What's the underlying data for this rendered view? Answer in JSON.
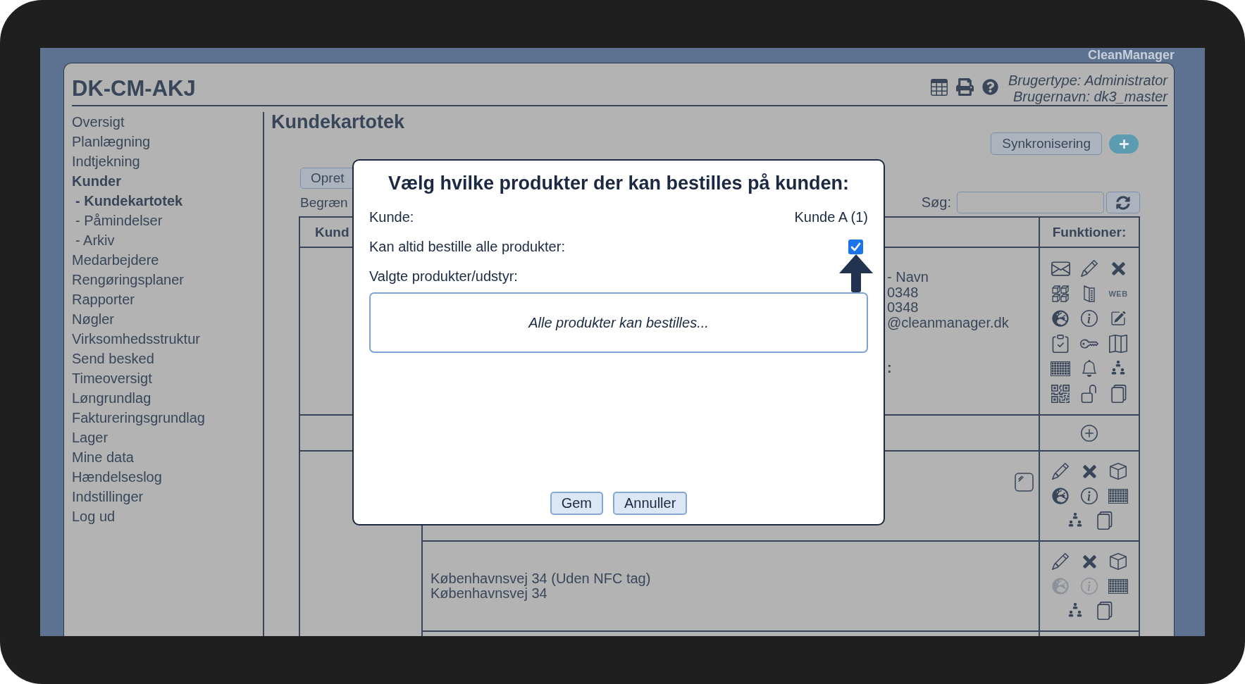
{
  "app_label": "CleanManager",
  "header": {
    "title": "DK-CM-AKJ",
    "user_type": "Brugertype: Administrator",
    "user_name": "Brugernavn: dk3_master"
  },
  "sidebar": {
    "items": [
      {
        "label": "Oversigt",
        "selected": false
      },
      {
        "label": "Planlægning",
        "selected": false
      },
      {
        "label": "Indtjekning",
        "selected": false
      },
      {
        "label": "Kunder",
        "selected": true,
        "children": [
          {
            "label": "- Kundekartotek",
            "selected": true
          },
          {
            "label": "- Påmindelser",
            "selected": false
          },
          {
            "label": "- Arkiv",
            "selected": false
          }
        ]
      },
      {
        "label": "Medarbejdere",
        "selected": false
      },
      {
        "label": "Rengøringsplaner",
        "selected": false
      },
      {
        "label": "Rapporter",
        "selected": false
      },
      {
        "label": "Nøgler",
        "selected": false
      },
      {
        "label": "Virksomhedsstruktur",
        "selected": false
      },
      {
        "label": "Send besked",
        "selected": false
      },
      {
        "label": "Timeoversigt",
        "selected": false
      },
      {
        "label": "Løngrundlag",
        "selected": false
      },
      {
        "label": "Faktureringsgrundlag",
        "selected": false
      },
      {
        "label": "Lager",
        "selected": false
      },
      {
        "label": "Mine data",
        "selected": false
      },
      {
        "label": "Hændelseslog",
        "selected": false
      },
      {
        "label": "Indstillinger",
        "selected": false
      },
      {
        "label": "Log ud",
        "selected": false
      }
    ]
  },
  "page": {
    "title": "Kundekartotek",
    "sync_button": "Synkronisering",
    "create_button": "Opret",
    "filter_label": "Begræn",
    "search": {
      "label": "Søg:"
    }
  },
  "table": {
    "columns": [
      "Kund",
      "Funktioner:"
    ],
    "rows": [
      {
        "kind": "customer",
        "details": [
          "- Navn",
          "0348",
          "0348",
          "@cleanmanager.dk"
        ],
        "details_tail": ":",
        "functions": [
          {
            "disabled": false
          },
          {
            "disabled": false
          },
          {
            "disabled": false
          },
          {
            "disabled": false
          },
          {
            "disabled": false
          },
          {
            "label": "WEB",
            "disabled": false
          },
          {
            "disabled": false
          },
          {
            "disabled": false
          },
          {
            "disabled": false
          },
          {
            "disabled": false
          },
          {
            "disabled": false
          },
          {
            "disabled": false
          },
          {
            "disabled": false
          },
          {
            "disabled": false
          },
          {
            "disabled": false
          },
          {
            "disabled": false
          },
          {
            "disabled": false
          },
          {
            "disabled": false
          }
        ]
      },
      {
        "kind": "add",
        "functions": [
          {
            "disabled": false
          }
        ]
      },
      {
        "kind": "address",
        "marked": true,
        "functions": [
          {
            "disabled": false
          },
          {
            "disabled": false
          },
          {
            "disabled": false
          },
          {
            "disabled": false
          },
          {
            "disabled": false
          },
          {
            "disabled": false
          },
          {
            "disabled": false
          },
          {
            "disabled": false
          }
        ]
      },
      {
        "kind": "address",
        "lines": [
          "Københavnsvej 34 (Uden NFC tag)",
          "Københavnsvej 34"
        ],
        "functions": [
          {
            "disabled": false
          },
          {
            "disabled": false
          },
          {
            "disabled": false
          },
          {
            "disabled": true
          },
          {
            "disabled": true
          },
          {
            "disabled": false
          },
          {
            "disabled": false
          },
          {
            "disabled": false
          }
        ]
      }
    ]
  },
  "dialog": {
    "title": "Vælg hvilke produkter der kan bestilles på kunden:",
    "fields": [
      {
        "kind": "text",
        "label": "Kunde:",
        "value": "Kunde A (1)"
      },
      {
        "kind": "checkbox",
        "label": "Kan altid bestille alle produkter:",
        "checked": true
      },
      {
        "kind": "list",
        "label": "Valgte produkter/udstyr:",
        "message": "Alle produkter kan bestilles..."
      }
    ],
    "buttons": [
      "Gem",
      "Annuller"
    ]
  }
}
